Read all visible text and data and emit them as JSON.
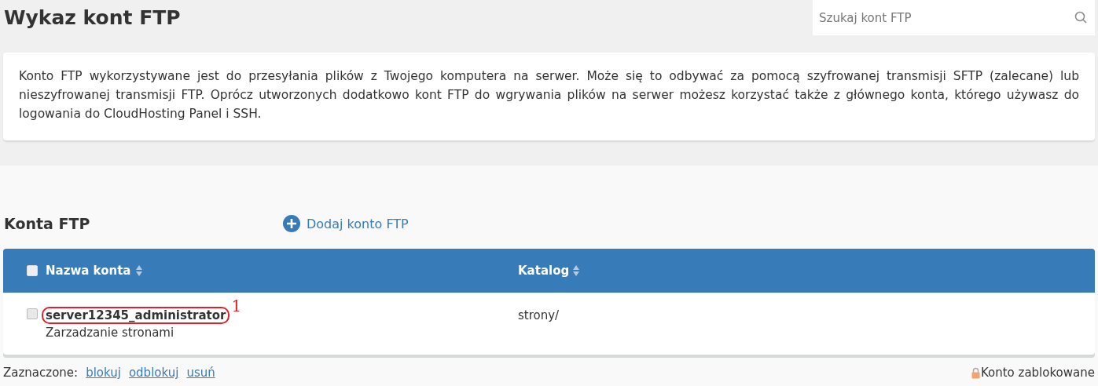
{
  "page_title": "Wykaz kont FTP",
  "search": {
    "placeholder": "Szukaj kont FTP"
  },
  "info": "Konto FTP wykorzystywane jest do przesyłania plików z Twojego komputera na serwer. Może się to odbywać za pomocą szyfrowanej transmisji SFTP (zalecane) lub nieszyfrowanej transmisji FTP. Oprócz utworzonych dodatkowo kont FTP do wgrywania plików na serwer możesz korzystać także z głównego konta, którego używasz do logowania do CloudHosting Panel i SSH.",
  "section_title": "Konta FTP",
  "add_button": "Dodaj konto FTP",
  "table": {
    "select_all_checked": false,
    "columns": [
      "Nazwa konta",
      "Katalog"
    ],
    "rows": [
      {
        "checked": false,
        "name": "server12345_administrator",
        "description": "Zarzadzanie stronami",
        "directory": "strony/",
        "annotation": "1"
      }
    ]
  },
  "footer": {
    "label": "Zaznaczone:",
    "actions": [
      "blokuj",
      "odblokuj",
      "usuń"
    ],
    "legend": "Konto zablokowane"
  }
}
